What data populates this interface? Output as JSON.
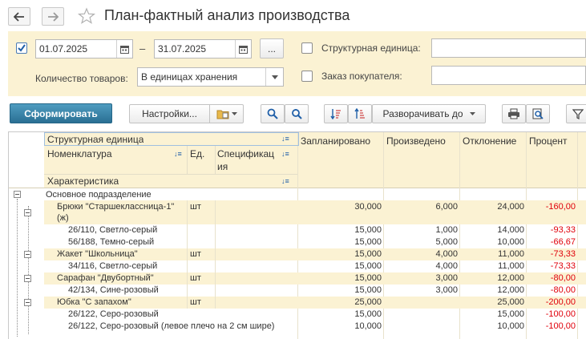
{
  "window": {
    "title": "План-фактный анализ производства"
  },
  "filters": {
    "date_from": "01.07.2025",
    "dash": "–",
    "date_to": "31.07.2025",
    "more_button": "...",
    "quantity_label": "Количество товаров:",
    "quantity_value": "В единицах хранения",
    "org_unit_label": "Структурная единица:",
    "org_unit_value": "",
    "customer_order_label": "Заказ покупателя:",
    "customer_order_value": ""
  },
  "toolbar": {
    "generate": "Сформировать",
    "settings": "Настройки...",
    "expand_to": "Разворачивать до"
  },
  "table": {
    "headers": {
      "org_unit": "Структурная единица",
      "nomenclature": "Номенклатура",
      "unit": "Ед.",
      "spec_line1": "Спецификац",
      "spec_line2": "ия",
      "characteristic": "Характеристика",
      "planned": "Запланировано",
      "produced": "Произведено",
      "deviation": "Отклонение",
      "percent": "Процент"
    },
    "group": "Основное подразделение",
    "rows": [
      {
        "name": "Брюки \"Старшеклассница-1\"",
        "name2": "(ж)",
        "unit": "шт",
        "planned": "30,000",
        "produced": "6,000",
        "deviation": "24,000",
        "percent": "-160,00"
      },
      {
        "name": "26/110, Светло-серый",
        "planned": "15,000",
        "produced": "1,000",
        "deviation": "14,000",
        "percent": "-93,33"
      },
      {
        "name": "56/188, Темно-серый",
        "planned": "15,000",
        "produced": "5,000",
        "deviation": "10,000",
        "percent": "-66,67"
      },
      {
        "name": "Жакет \"Школьница\"",
        "unit": "шт",
        "planned": "15,000",
        "produced": "4,000",
        "deviation": "11,000",
        "percent": "-73,33"
      },
      {
        "name": "34/116, Светло-серый",
        "planned": "15,000",
        "produced": "4,000",
        "deviation": "11,000",
        "percent": "-73,33"
      },
      {
        "name": "Сарафан \"Двубортный\"",
        "unit": "шт",
        "planned": "15,000",
        "produced": "3,000",
        "deviation": "12,000",
        "percent": "-80,00"
      },
      {
        "name": "42/134, Сине-розовый",
        "planned": "15,000",
        "produced": "3,000",
        "deviation": "12,000",
        "percent": "-80,00"
      },
      {
        "name": "Юбка \"С запахом\"",
        "unit": "шт",
        "planned": "25,000",
        "produced": "",
        "deviation": "25,000",
        "percent": "-200,00"
      },
      {
        "name": "26/122, Серо-розовый",
        "planned": "15,000",
        "produced": "",
        "deviation": "15,000",
        "percent": "-100,00"
      },
      {
        "name": "26/122, Серо-розовый (левое плечо на 2 см шире)",
        "planned": "10,000",
        "produced": "",
        "deviation": "10,000",
        "percent": "-100,00"
      }
    ]
  },
  "colors": {
    "panel_bg": "#fbf2d3",
    "primary_button": "#2f7ca2",
    "negative": "#e0000a"
  }
}
